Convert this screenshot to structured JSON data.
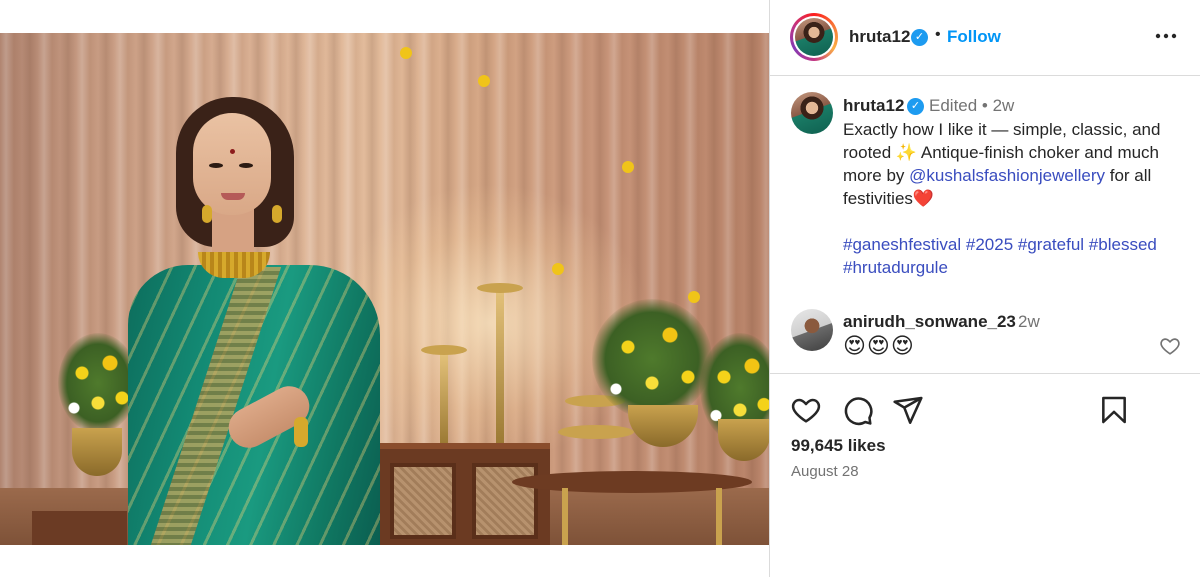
{
  "post": {
    "username": "hruta12",
    "follow_label": "Follow",
    "dot": "•",
    "more_label": "•••"
  },
  "caption": {
    "username": "hruta12",
    "meta": "Edited • 2w",
    "text_part1": "Exactly how I like it — simple, classic, and rooted ✨ Antique-finish choker and much more by ",
    "mention": "@kushalsfashionjewellery",
    "text_part2": " for all festivities❤️",
    "hashtags": [
      "#ganeshfestival",
      "#2025",
      "#grateful",
      "#blessed",
      "#hrutadurgule"
    ]
  },
  "comment": {
    "username": "anirudh_sonwane_23",
    "time": "2w",
    "text": "😍😍😍"
  },
  "stats": {
    "likes": "99,645 likes",
    "date": "August 28"
  },
  "icons": {
    "verified": "verified-badge-icon",
    "like": "heart-icon",
    "comment": "comment-bubble-icon",
    "share": "paper-plane-icon",
    "save": "bookmark-icon",
    "more": "more-options-icon"
  },
  "colors": {
    "link": "#0095f6",
    "hashtag": "#3a4dbf",
    "verified": "#1d9bf0",
    "muted": "#737373",
    "divider": "#dbdbdb"
  }
}
